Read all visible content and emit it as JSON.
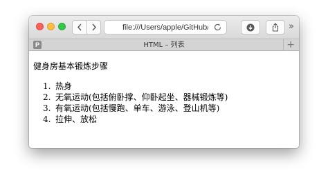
{
  "toolbar": {
    "address_url": "file:///Users/apple/GitHub/R",
    "nav_back_icon": "chevron-left-icon",
    "nav_forward_icon": "chevron-right-icon",
    "reload_icon": "reload-icon",
    "download_icon": "download-icon",
    "share_icon": "share-icon",
    "overflow_label": "»"
  },
  "tabbar": {
    "favicon_letter": "P",
    "title": "HTML – 列表",
    "new_tab_label": "+"
  },
  "content": {
    "heading": "健身房基本锻炼步骤",
    "items": [
      {
        "num": "1.",
        "text": "热身"
      },
      {
        "num": "2.",
        "text": "无氧运动(包括俯卧撑、仰卧起坐、器械锻炼等)"
      },
      {
        "num": "3.",
        "text": "有氧运动(包括慢跑、单车、游泳、登山机等)"
      },
      {
        "num": "4.",
        "text": "拉伸、放松"
      }
    ]
  },
  "colors": {
    "close": "#fc605c",
    "minimize": "#fdbc40",
    "zoom": "#34c84a"
  }
}
